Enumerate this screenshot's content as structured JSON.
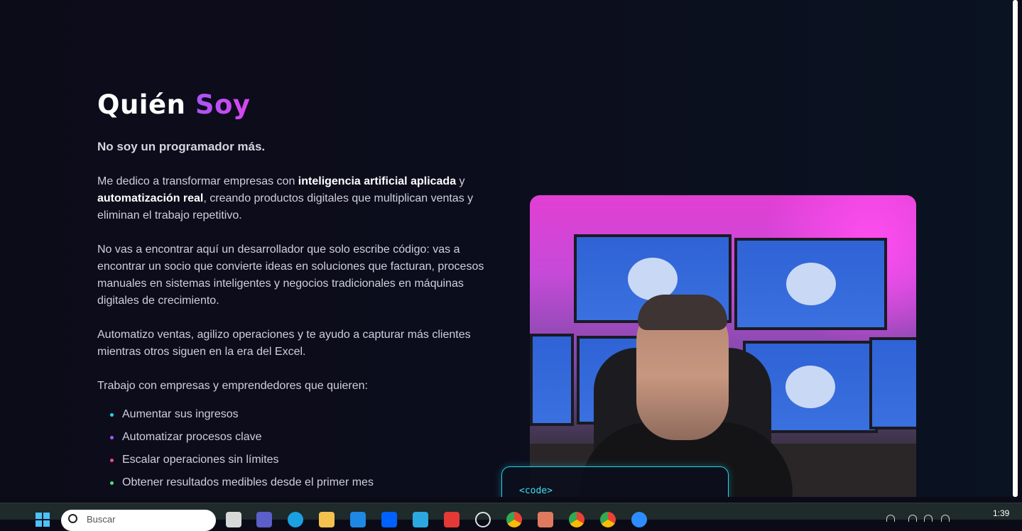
{
  "about": {
    "title_main": "Quién",
    "title_accent": "Soy",
    "subtitle": "No soy un programador más.",
    "p1_a": "Me dedico a transformar empresas con ",
    "p1_b": "inteligencia artificial aplicada",
    "p1_c": " y ",
    "p1_d": "automatización real",
    "p1_e": ", creando productos digitales que multiplican ventas y eliminan el trabajo repetitivo.",
    "p2": "No vas a encontrar aquí un desarrollador que solo escribe código: vas a encontrar un socio que convierte ideas en soluciones que facturan, procesos manuales en sistemas inteligentes y negocios tradicionales en máquinas digitales de crecimiento.",
    "p3": "Automatizo ventas, agilizo operaciones y te ayudo a capturar más clientes mientras otros siguen en la era del Excel.",
    "p4": "Trabajo con empresas y emprendedores que quieren:",
    "bullets": [
      {
        "text": "Aumentar sus ingresos",
        "color": "#22d3ee"
      },
      {
        "text": "Automatizar procesos clave",
        "color": "#a855f7"
      },
      {
        "text": "Escalar operaciones sin límites",
        "color": "#ec4899"
      },
      {
        "text": "Obtener resultados medibles desde el primer mes",
        "color": "#4ade80"
      }
    ]
  },
  "code_card": {
    "tag": "<code>"
  },
  "taskbar": {
    "search_placeholder": "Buscar",
    "time": "1:39"
  },
  "colors": {
    "accent_purple": "#a855f7",
    "accent_cyan": "#23d5e8",
    "background": "#0c0c19"
  }
}
